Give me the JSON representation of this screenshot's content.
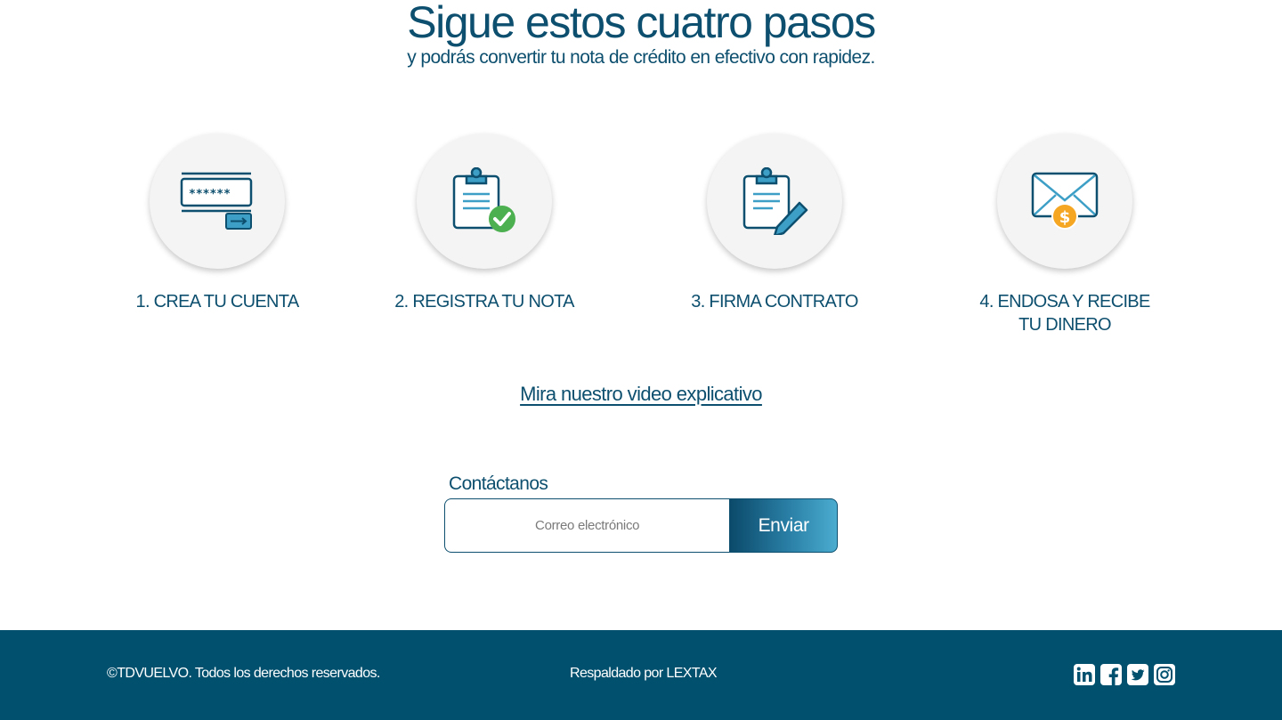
{
  "hero": {
    "title": "Sigue estos cuatro pasos",
    "subtitle": "y podrás convertir tu nota de crédito en efectivo con rapidez."
  },
  "steps": [
    {
      "label": "1. CREA TU CUENTA",
      "icon": "password-login-icon"
    },
    {
      "label": "2. REGISTRA TU NOTA",
      "icon": "clipboard-check-icon"
    },
    {
      "label": "3. FIRMA CONTRATO",
      "icon": "clipboard-sign-icon"
    },
    {
      "label": "4. ENDOSA Y RECIBE\nTU DINERO",
      "icon": "envelope-money-icon"
    }
  ],
  "video_link": "Mira nuestro video explicativo",
  "contact": {
    "label": "Contáctanos",
    "email_placeholder": "Correo electrónico",
    "email_value": "",
    "send_label": "Enviar"
  },
  "footer": {
    "copyright": "©TDVUELVO. Todos los derechos reservados.",
    "backed_by": "Respaldado por LEXTAX",
    "social": [
      "linkedin-icon",
      "facebook-icon",
      "twitter-icon",
      "instagram-icon"
    ]
  },
  "colors": {
    "primary": "#0d4f6e",
    "footer_bg": "#00506e",
    "icon_blue": "#3d9fc6",
    "check_green": "#4caf50",
    "coin_orange": "#f5a623"
  }
}
